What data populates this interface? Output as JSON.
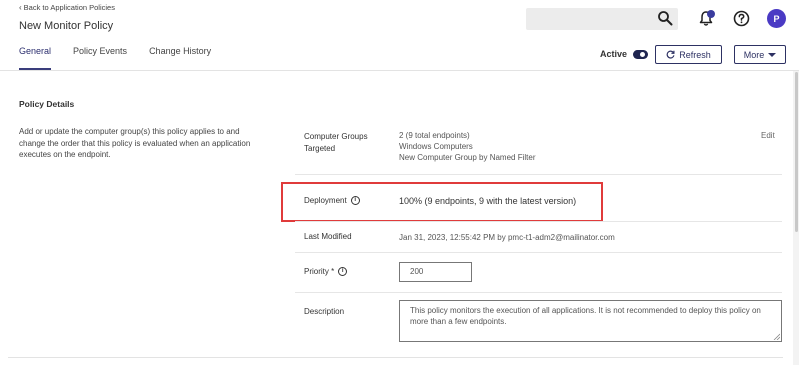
{
  "header": {
    "back_link": "Back to Application Policies",
    "page_title": "New Monitor Policy",
    "avatar_initial": "P",
    "icons": [
      "search-icon",
      "bell-icon",
      "help-icon"
    ],
    "accent_color": "#4a3ac4"
  },
  "tabs": [
    {
      "label": "General",
      "active": true
    },
    {
      "label": "Policy Events",
      "active": false
    },
    {
      "label": "Change History",
      "active": false
    }
  ],
  "actions": {
    "active_label": "Active",
    "active_on": true,
    "refresh_label": "Refresh",
    "more_label": "More"
  },
  "policy_details": {
    "title": "Policy Details",
    "description": "Add or update the computer group(s) this policy applies to and change the order that this policy is evaluated when an application executes on the endpoint.",
    "edit_label": "Edit",
    "computer_groups": {
      "label": "Computer Groups Targeted",
      "summary": "2 (9 total endpoints)",
      "groups": [
        "Windows Computers",
        "New Computer Group by Named Filter"
      ]
    },
    "deployment": {
      "label": "Deployment",
      "value": "100% (9 endpoints, 9 with the latest version)",
      "highlight_color": "#e03b3b"
    },
    "last_modified": {
      "label": "Last Modified",
      "value": "Jan 31, 2023, 12:55:42 PM by pmc-t1-adm2@mailinator.com"
    },
    "priority": {
      "label": "Priority *",
      "value": "200"
    },
    "description_field": {
      "label": "Description",
      "value": "This policy monitors the execution of all applications. It is not recommended to deploy this policy on more than a few endpoints."
    }
  }
}
